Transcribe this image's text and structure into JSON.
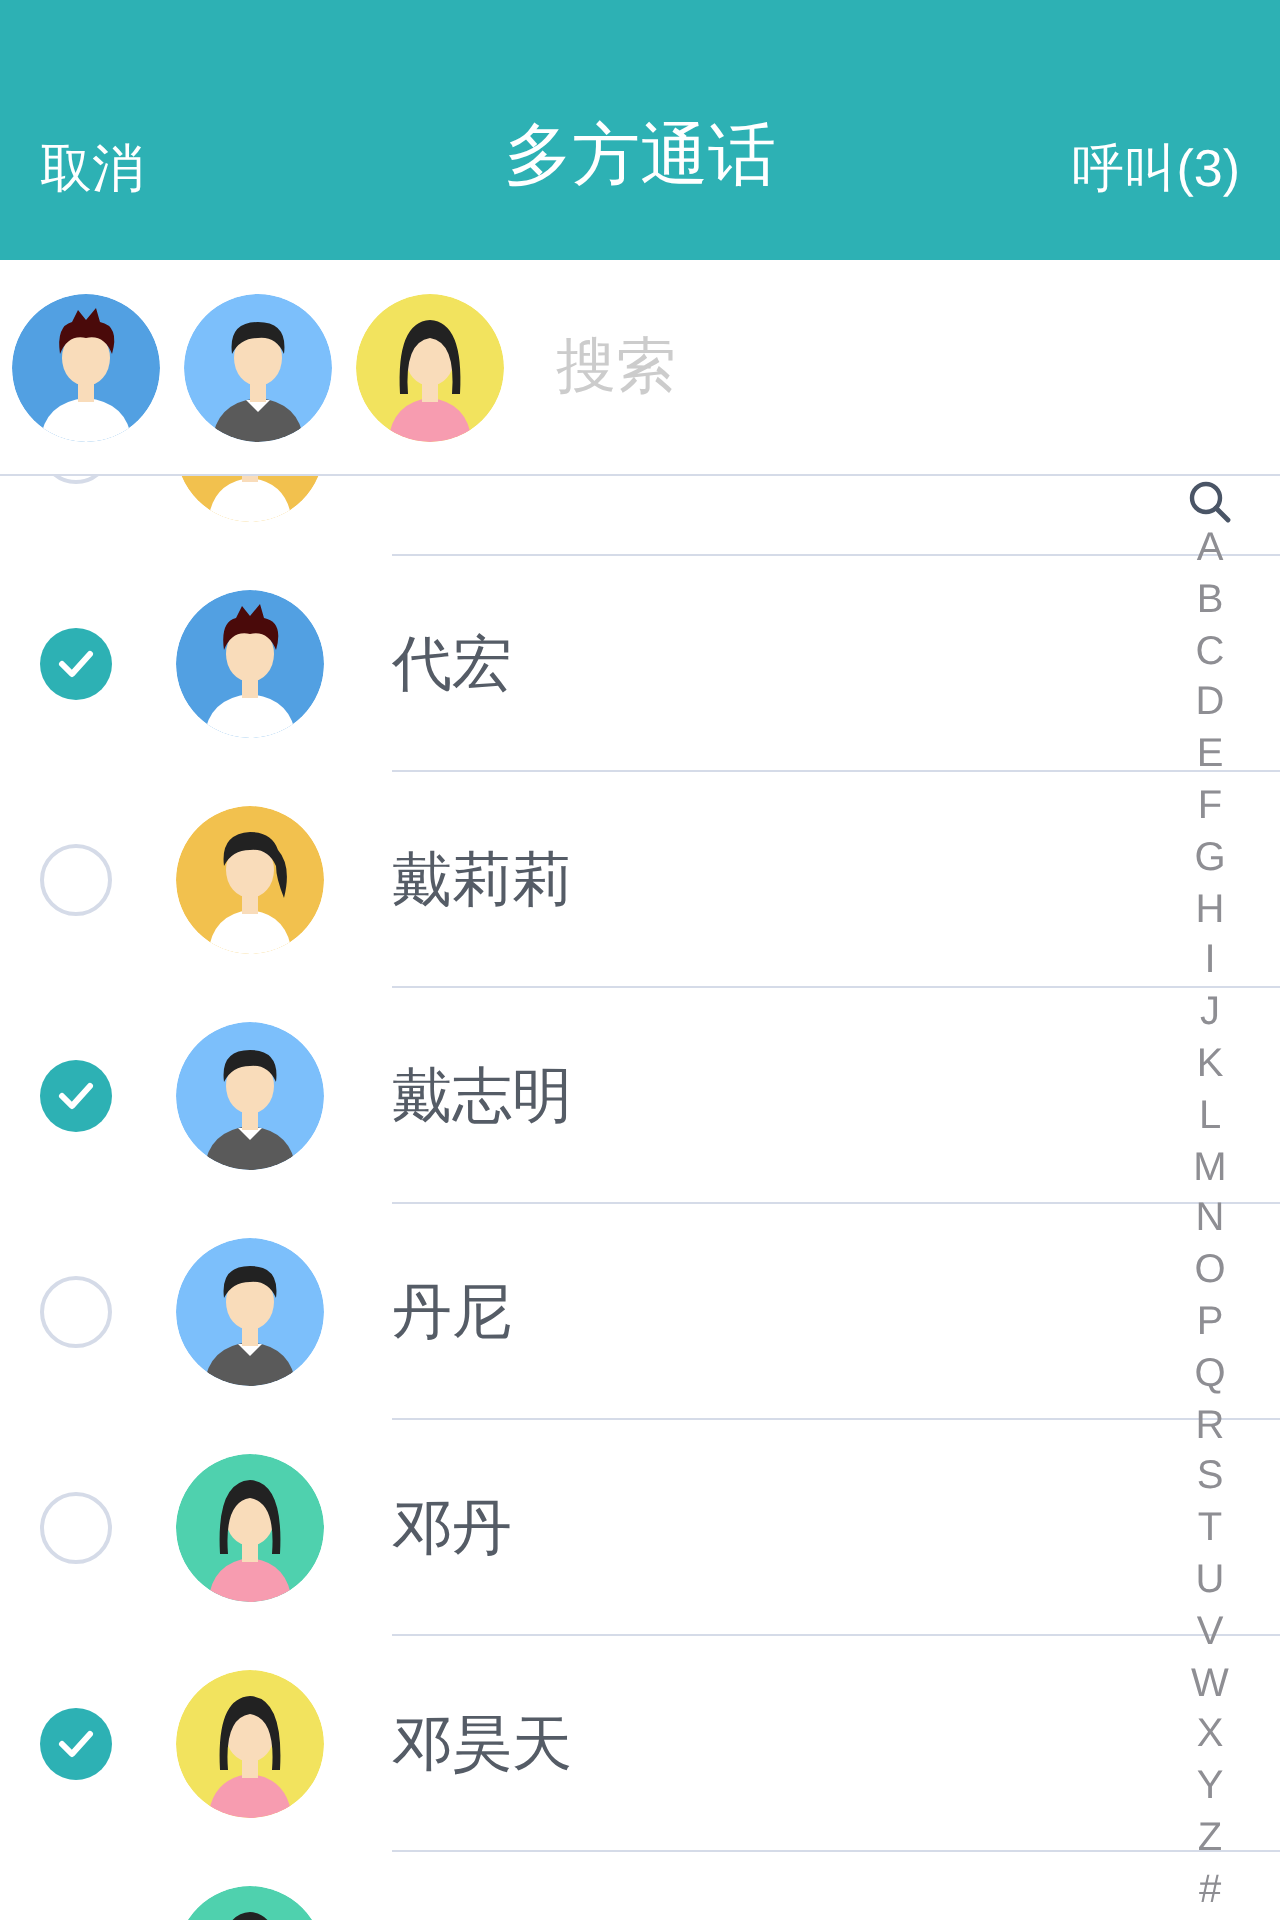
{
  "header": {
    "cancel": "取消",
    "title": "多方通话",
    "call": "呼叫(3)"
  },
  "selected_strip": {
    "avatars": [
      {
        "kind": "man-spiky",
        "color": "#52a0e2"
      },
      {
        "kind": "man-sweater",
        "color": "#7cbffb"
      },
      {
        "kind": "woman-long-hair",
        "color": "#f2e35e"
      }
    ],
    "search": {
      "placeholder": "搜索"
    }
  },
  "contacts": [
    {
      "selected": false,
      "avatar": {
        "kind": "woman-ponytail",
        "color": "#f2c14e"
      }
    },
    {
      "name": "代宏",
      "selected": true,
      "avatar": {
        "kind": "man-spiky",
        "color": "#52a0e2"
      }
    },
    {
      "name": "戴莉莉",
      "selected": false,
      "avatar": {
        "kind": "woman-ponytail",
        "color": "#f2c14e"
      }
    },
    {
      "name": "戴志明",
      "selected": true,
      "avatar": {
        "kind": "man-sweater",
        "color": "#7cbffb"
      }
    },
    {
      "name": "丹尼",
      "selected": false,
      "avatar": {
        "kind": "man-sweater",
        "color": "#7cbffb"
      }
    },
    {
      "name": "邓丹",
      "selected": false,
      "avatar": {
        "kind": "woman-long-hair",
        "color": "#4fd1ae"
      }
    },
    {
      "name": "邓昊天",
      "selected": true,
      "avatar": {
        "kind": "woman-long-hair",
        "color": "#f2e35e"
      }
    },
    {
      "avatar": {
        "kind": "woman-long-hair",
        "color": "#4fd1ae"
      }
    }
  ],
  "index": [
    "A",
    "B",
    "C",
    "D",
    "E",
    "F",
    "G",
    "H",
    "I",
    "J",
    "K",
    "L",
    "M",
    "N",
    "O",
    "P",
    "Q",
    "R",
    "S",
    "T",
    "U",
    "V",
    "W",
    "X",
    "Y",
    "Z",
    "#"
  ]
}
